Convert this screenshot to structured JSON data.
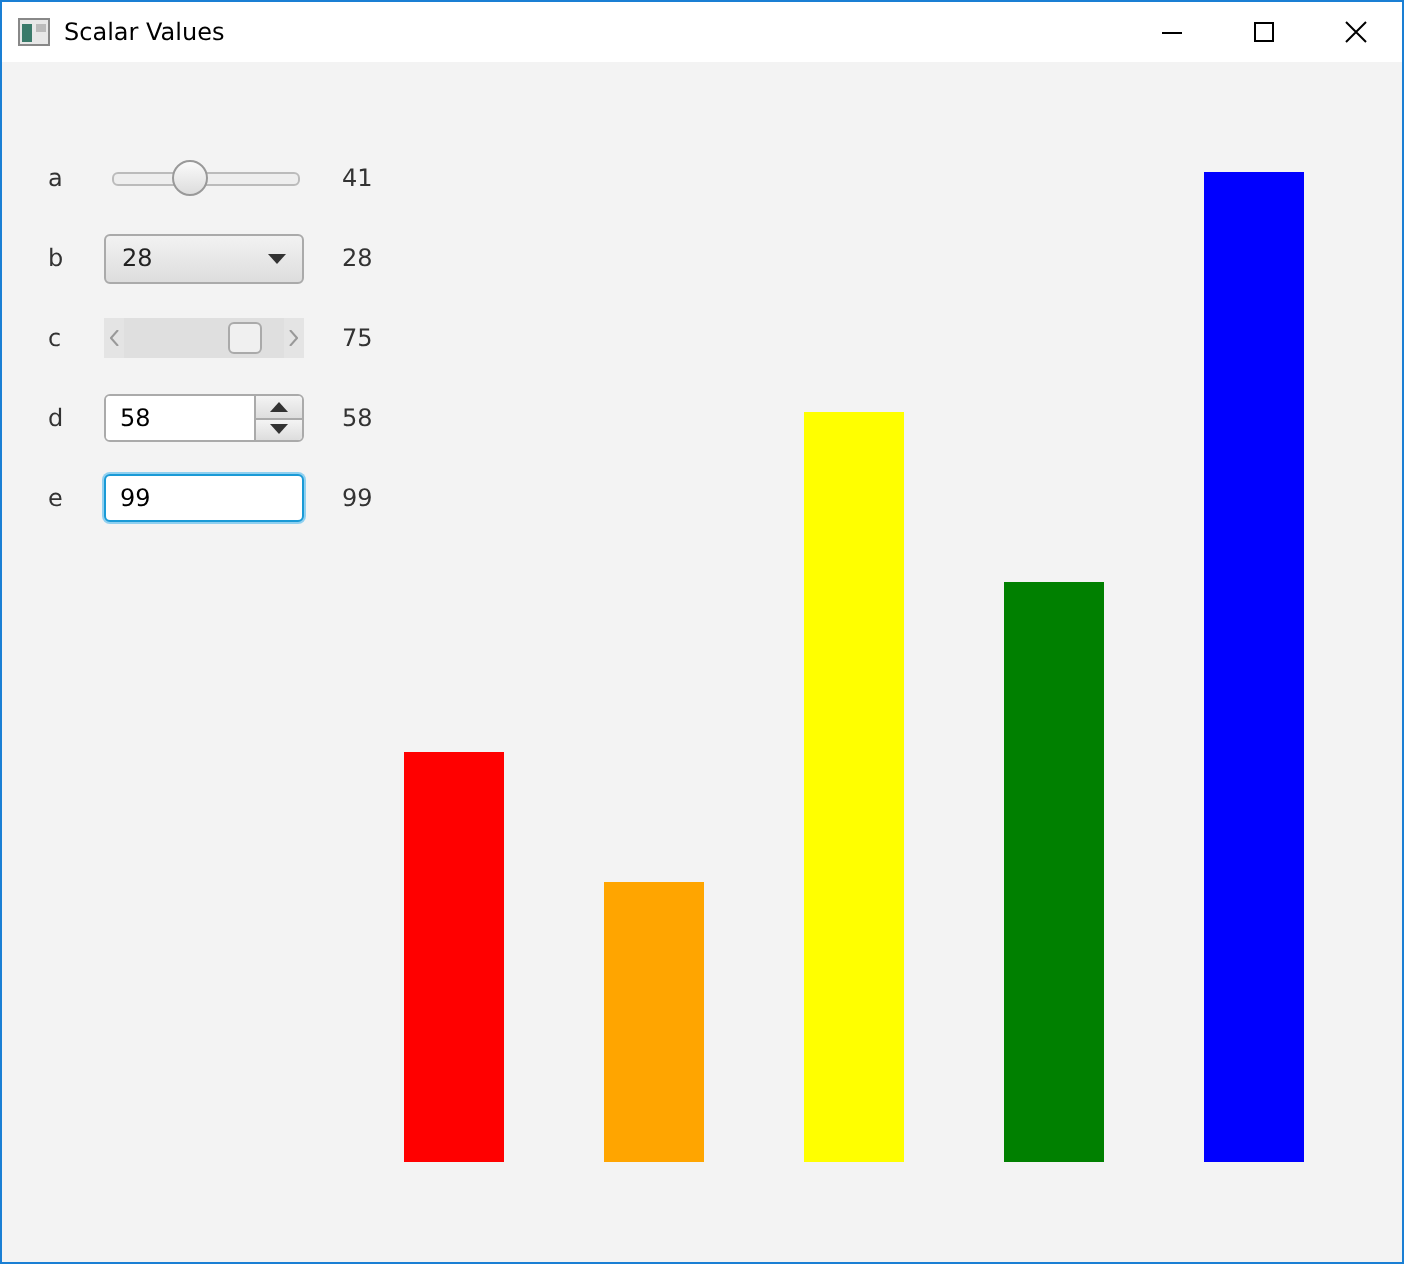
{
  "window": {
    "title": "Scalar Values"
  },
  "controls": [
    {
      "label": "a",
      "kind": "slider",
      "level": 0.41,
      "reading": "41"
    },
    {
      "label": "b",
      "kind": "combo",
      "value": "28",
      "reading": "28"
    },
    {
      "label": "c",
      "kind": "scrollbar",
      "level": 0.75,
      "reading": "75"
    },
    {
      "label": "d",
      "kind": "spinner",
      "value": "58",
      "reading": "58"
    },
    {
      "label": "e",
      "kind": "text",
      "value": "99",
      "focused": true,
      "reading": "99"
    }
  ],
  "bars": [
    {
      "color": "#ff0000"
    },
    {
      "color": "#ffa500"
    },
    {
      "color": "#ffff00"
    },
    {
      "color": "#008000"
    },
    {
      "color": "#0000ff"
    }
  ]
}
